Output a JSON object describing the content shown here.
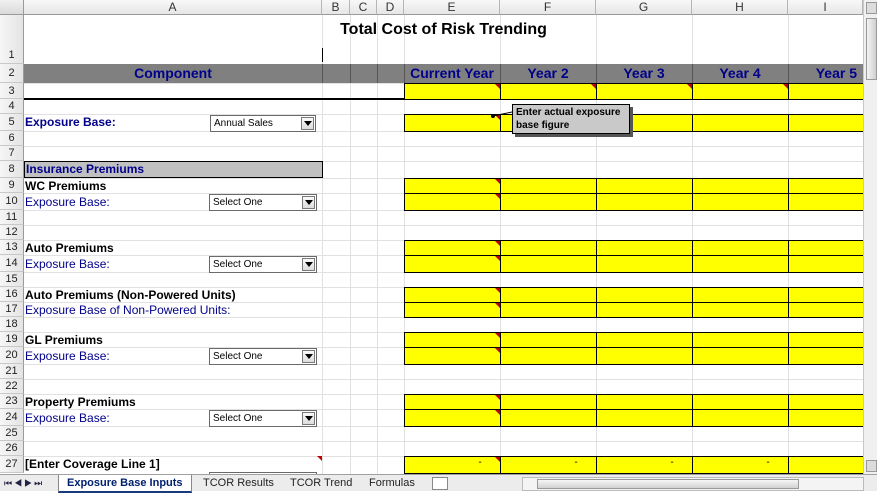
{
  "columns": [
    "A",
    "B",
    "C",
    "D",
    "E",
    "F",
    "G",
    "H",
    "I"
  ],
  "rows": [
    "1",
    "2",
    "3",
    "4",
    "5",
    "6",
    "7",
    "8",
    "9",
    "10",
    "11",
    "12",
    "13",
    "14",
    "15",
    "16",
    "17",
    "18",
    "19",
    "20",
    "21",
    "22",
    "23",
    "24",
    "25",
    "26",
    "27"
  ],
  "title": "Total Cost of Risk Trending",
  "header": {
    "component": "Component",
    "years": [
      "Current Year",
      "Year 2",
      "Year 3",
      "Year 4",
      "Year 5"
    ]
  },
  "exposure": {
    "label": "Exposure Base:",
    "select": "Annual Sales"
  },
  "callout": "Enter actual exposure base figure",
  "section_header": "Insurance Premiums",
  "blocks": [
    {
      "title": "WC Premiums",
      "sub": "Exposure Base:",
      "select": "Select One"
    },
    {
      "title": "Auto Premiums",
      "sub": "Exposure Base:",
      "select": "Select One"
    },
    {
      "title": "Auto Premiums (Non-Powered Units)",
      "sub": "Exposure Base of Non-Powered Units:",
      "select": ""
    },
    {
      "title": "GL Premiums",
      "sub": "Exposure Base:",
      "select": "Select One"
    },
    {
      "title": "Property Premiums",
      "sub": "Exposure Base:",
      "select": "Select One"
    }
  ],
  "coverage_line": "[Enter Coverage Line 1]",
  "dash": "-",
  "tabs": [
    "Exposure Base Inputs",
    "TCOR Results",
    "TCOR Trend",
    "Formulas"
  ],
  "colors": {
    "yellow": "#ffff00",
    "header_bar": "#808080",
    "header_text": "#00008b"
  }
}
